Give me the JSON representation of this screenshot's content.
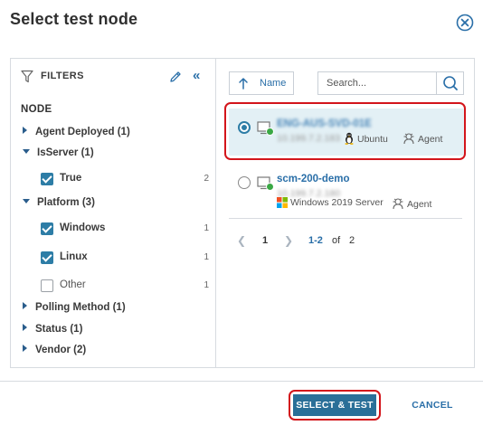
{
  "dialog": {
    "title": "Select test node",
    "close_icon": "close-circle-icon"
  },
  "filters": {
    "header": "FILTERS",
    "filter_icon": "funnel-icon",
    "edit_icon": "pencil-icon",
    "collapse_glyph": "«",
    "section_label": "NODE",
    "groups": [
      {
        "label": "Agent Deployed (1)",
        "expanded": false
      },
      {
        "label": "IsServer (1)",
        "expanded": true,
        "options": [
          {
            "label": "True",
            "count": "2",
            "checked": true
          }
        ]
      },
      {
        "label": "Platform (3)",
        "expanded": true,
        "options": [
          {
            "label": "Windows",
            "count": "1",
            "checked": true
          },
          {
            "label": "Linux",
            "count": "1",
            "checked": true
          },
          {
            "label": "Other",
            "count": "1",
            "checked": false
          }
        ]
      },
      {
        "label": "Polling Method (1)",
        "expanded": false
      },
      {
        "label": "Status (1)",
        "expanded": false
      },
      {
        "label": "Vendor (2)",
        "expanded": false
      }
    ]
  },
  "toolbar": {
    "sort_label": "Name",
    "search_placeholder": "Search..."
  },
  "nodes": [
    {
      "name": "ENG-AUS-SVD-01E",
      "ip": "10.199.7.2.183",
      "selected": true,
      "os_icon": "linux-penguin-icon",
      "os": "Ubuntu",
      "agent_icon": "agent-icon",
      "polling": "Agent",
      "status_color": "#3aa845"
    },
    {
      "name": "scm-200-demo",
      "ip": "10.199.7.2.180",
      "selected": false,
      "os_icon": "windows-logo-icon",
      "os": "Windows 2019 Server",
      "agent_icon": "agent-icon",
      "polling": "Agent",
      "status_color": "#3aa845"
    }
  ],
  "pager": {
    "current": "1",
    "range": "1-2",
    "of": "of",
    "total": "2"
  },
  "footer": {
    "primary_label": "SELECT & TEST",
    "cancel_label": "CANCEL"
  },
  "colors": {
    "accent": "#2a6f98",
    "link": "#2a6fa8",
    "highlight": "#d3151b",
    "selected_row": "#e3f0f5"
  }
}
